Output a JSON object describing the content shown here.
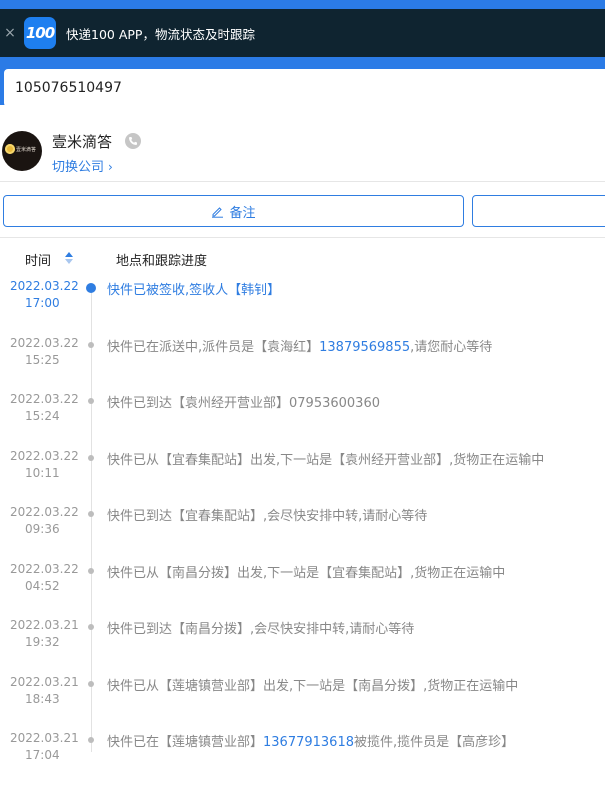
{
  "banner": {
    "close_glyph": "×",
    "logo_text": "100",
    "text": "快递100 APP，物流状态及时跟踪"
  },
  "search": {
    "value": "105076510497"
  },
  "company": {
    "logo_text": "壹米滴答",
    "name": "壹米滴答",
    "switch_label": "切换公司",
    "switch_chevron": "›"
  },
  "actions": {
    "note_label": "备注"
  },
  "table": {
    "col_time": "时间",
    "col_progress": "地点和跟踪进度"
  },
  "events": [
    {
      "date": "2022.03.22",
      "time": "17:00",
      "text": "快件已被签收,签收人【韩钊】",
      "phone": "",
      "tail": ""
    },
    {
      "date": "2022.03.22",
      "time": "15:25",
      "text": "快件已在派送中,派件员是【袁海红】",
      "phone": "13879569855",
      "tail": ",请您耐心等待"
    },
    {
      "date": "2022.03.22",
      "time": "15:24",
      "text": "快件已到达【袁州经开营业部】07953600360",
      "phone": "",
      "tail": ""
    },
    {
      "date": "2022.03.22",
      "time": "10:11",
      "text": "快件已从【宜春集配站】出发,下一站是【袁州经开营业部】,货物正在运输中",
      "phone": "",
      "tail": ""
    },
    {
      "date": "2022.03.22",
      "time": "09:36",
      "text": "快件已到达【宜春集配站】,会尽快安排中转,请耐心等待",
      "phone": "",
      "tail": ""
    },
    {
      "date": "2022.03.22",
      "time": "04:52",
      "text": "快件已从【南昌分拨】出发,下一站是【宜春集配站】,货物正在运输中",
      "phone": "",
      "tail": ""
    },
    {
      "date": "2022.03.21",
      "time": "19:32",
      "text": "快件已到达【南昌分拨】,会尽快安排中转,请耐心等待",
      "phone": "",
      "tail": ""
    },
    {
      "date": "2022.03.21",
      "time": "18:43",
      "text": "快件已从【莲塘镇营业部】出发,下一站是【南昌分拨】,货物正在运输中",
      "phone": "",
      "tail": ""
    },
    {
      "date": "2022.03.21",
      "time": "17:04",
      "text": "快件已在【莲塘镇营业部】",
      "phone": "13677913618",
      "tail": "被揽件,揽件员是【高彦珍】"
    }
  ],
  "colors": {
    "accent": "#2f7de1",
    "header_bar": "#2b7be6",
    "banner_bg": "#0f2430"
  }
}
